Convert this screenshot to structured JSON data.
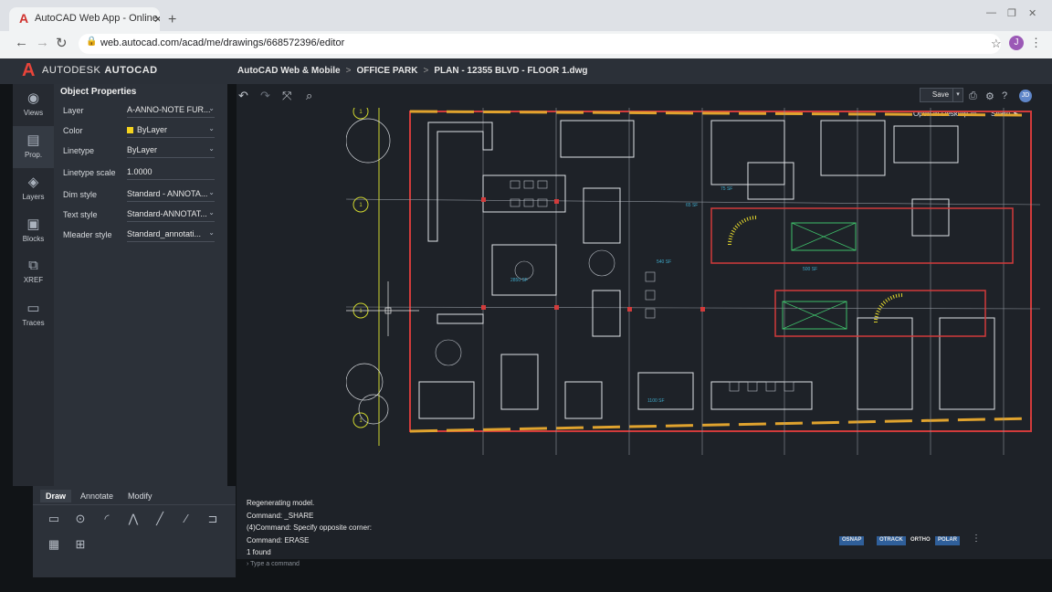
{
  "browser": {
    "tab_title": "AutoCAD Web App - Online CAD",
    "url": "web.autocad.com/acad/me/drawings/668572396/editor",
    "profile_initial": "J"
  },
  "app": {
    "brand": "AUTODESK",
    "product": "AUTOCAD",
    "breadcrumbs": [
      "AutoCAD Web & Mobile",
      "OFFICE PARK",
      "PLAN - 12355 BLVD - FLOOR 1.dwg"
    ],
    "accent_color": "#e8443a"
  },
  "rail": [
    {
      "label": "Views",
      "icon": "eye-icon"
    },
    {
      "label": "Prop.",
      "icon": "properties-icon"
    },
    {
      "label": "Layers",
      "icon": "layers-icon"
    },
    {
      "label": "Blocks",
      "icon": "blocks-icon"
    },
    {
      "label": "XREF",
      "icon": "xref-icon"
    },
    {
      "label": "Traces",
      "icon": "traces-icon"
    }
  ],
  "properties": {
    "title": "Object Properties",
    "rows": [
      {
        "label": "Layer",
        "value": "A-ANNO-NOTE FUR..."
      },
      {
        "label": "Color",
        "value": "ByLayer",
        "swatch": "#f5d31e"
      },
      {
        "label": "Linetype",
        "value": "ByLayer"
      },
      {
        "label": "Linetype scale",
        "value": "1.0000"
      },
      {
        "label": "Dim style",
        "value": "Standard - ANNOTA..."
      },
      {
        "label": "Text style",
        "value": "Standard-ANNOTAT..."
      },
      {
        "label": "Mleader style",
        "value": "Standard_annotati..."
      }
    ]
  },
  "palette": {
    "tabs": [
      "Draw",
      "Annotate",
      "Modify"
    ],
    "active_tab": "Draw"
  },
  "toolbar": {
    "save_label": "Save",
    "open_in_desktop": "Open In Desktop",
    "share": "Share",
    "user_initials": "JD"
  },
  "command": {
    "history": [
      "Regenerating model.",
      "Command: _SHARE",
      "(4)Command: Specify opposite corner:",
      "Command: ERASE",
      "1 found"
    ],
    "placeholder": "Type a command"
  },
  "status": [
    {
      "label": "OSNAP",
      "on": true
    },
    {
      "label": "OTRACK",
      "on": true
    },
    {
      "label": "ORTHO",
      "on": false
    },
    {
      "label": "POLAR",
      "on": true
    }
  ],
  "drawing_labels": {
    "room_a": "2850 SF",
    "room_b": "540 SF",
    "room_c": "500 SF",
    "room_d": "1100 SF",
    "room_e": "75 SF",
    "room_f": "65 SF",
    "grid_1": "1",
    "grid_2": "1",
    "grid_3": "1",
    "grid_4": "1"
  }
}
